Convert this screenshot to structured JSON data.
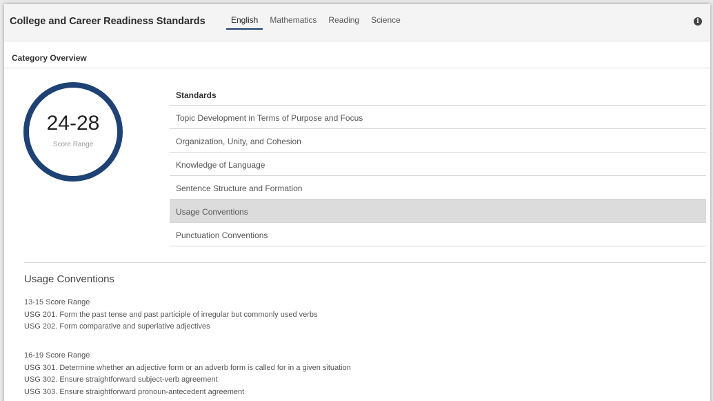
{
  "header": {
    "title": "College and Career Readiness Standards",
    "tabs": [
      {
        "label": "English",
        "active": true
      },
      {
        "label": "Mathematics",
        "active": false
      },
      {
        "label": "Reading",
        "active": false
      },
      {
        "label": "Science",
        "active": false
      }
    ],
    "info_icon": "info-icon"
  },
  "overview": {
    "heading": "Category Overview",
    "score_value": "24-28",
    "score_label": "Score Range"
  },
  "standards": {
    "header": "Standards",
    "items": [
      "Topic Development in Terms of Purpose and Focus",
      "Organization, Unity, and Cohesion",
      "Knowledge of Language",
      "Sentence Structure and Formation",
      "Usage Conventions",
      "Punctuation Conventions"
    ],
    "selected": "Usage Conventions"
  },
  "detail": {
    "title": "Usage Conventions",
    "groups": [
      {
        "range": "13-15 Score Range",
        "items": [
          "USG 201. Form the past tense and past participle of irregular but commonly used verbs",
          "USG 202. Form comparative and superlative adjectives"
        ]
      },
      {
        "range": "16-19 Score Range",
        "items": [
          "USG 301. Determine whether an adjective form or an adverb form is called for in a given situation",
          "USG 302. Ensure straightforward subject-verb agreement",
          "USG 303. Ensure straightforward pronoun-antecedent agreement"
        ]
      }
    ]
  },
  "colors": {
    "ring": "#1e4274",
    "active_tab_underline": "#1f3f6e",
    "selected_row": "#dcdcdc"
  }
}
